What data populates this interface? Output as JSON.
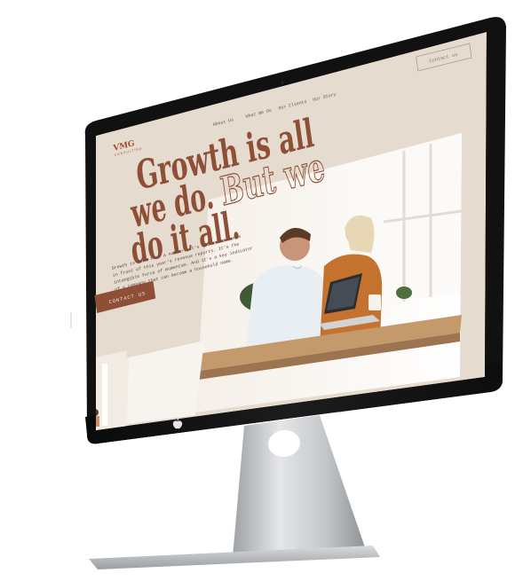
{
  "site": {
    "logo": "VMG",
    "logo_sub": "CONSULTING",
    "nav": [
      {
        "label": "About Us"
      },
      {
        "label": "What We Do"
      },
      {
        "label": "Our Clients"
      },
      {
        "label": "Our Story"
      }
    ],
    "contact_top_label": "Contact us",
    "headline_line1": "Growth is all",
    "headline_line2_solid": "we do.",
    "headline_line2_outline": "But we",
    "headline_line3": "do it all.",
    "body_lines": [
      "Growth is more than a number. It's the extra comma",
      "in front of this year's revenue reports. It's the",
      "intangible force of momentum. And it's a key indicator",
      "of a company that can become a household name."
    ],
    "cta_label": "CONTACT US"
  },
  "colors": {
    "screen_bg": "#e8ddd1",
    "accent": "#8e4f36",
    "bezel": "#141414",
    "stand": "#c9c9c9"
  }
}
